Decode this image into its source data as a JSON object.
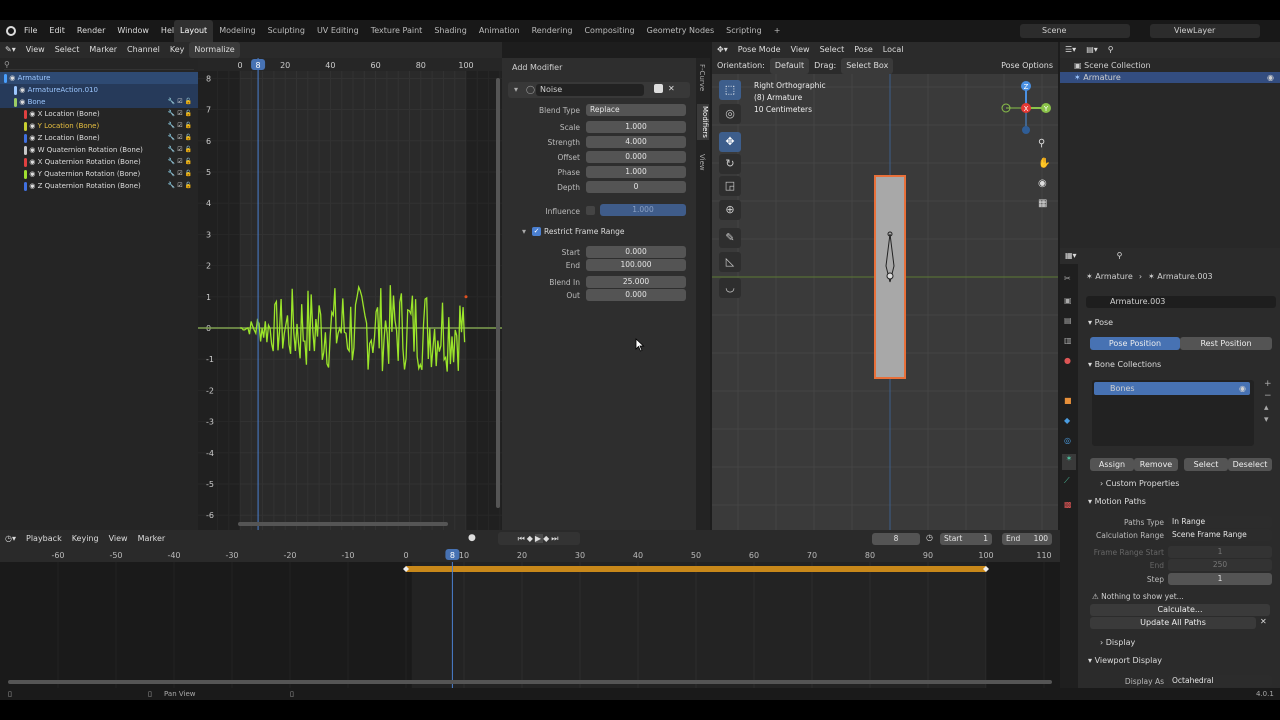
{
  "topbar": {
    "menus": [
      "File",
      "Edit",
      "Render",
      "Window",
      "Help"
    ],
    "workspaces": [
      "Layout",
      "Modeling",
      "Sculpting",
      "UV Editing",
      "Texture Paint",
      "Shading",
      "Animation",
      "Rendering",
      "Compositing",
      "Geometry Nodes",
      "Scripting"
    ],
    "active_workspace": "Layout",
    "add_tab": "+",
    "scene": "Scene",
    "viewlayer": "ViewLayer"
  },
  "graph": {
    "menus": [
      "View",
      "Select",
      "Marker",
      "Channel",
      "Key"
    ],
    "normalize": "Normalize",
    "ruler_x": [
      "0",
      "20",
      "40",
      "60",
      "80",
      "100"
    ],
    "current_frame": "8",
    "ruler_y": [
      "8",
      "7",
      "6",
      "5",
      "4",
      "3",
      "2",
      "1",
      "0",
      "-1",
      "-2",
      "-3",
      "-4",
      "-5",
      "-6"
    ],
    "channels": [
      {
        "name": "Armature",
        "color": "#4aa0ff",
        "level": 0
      },
      {
        "name": "ArmatureAction.010",
        "color": "#9cc7ff",
        "level": 1
      },
      {
        "name": "Bone",
        "color": "#9ccc65",
        "level": 1
      },
      {
        "name": "X Location (Bone)",
        "color": "#e04040",
        "level": 2
      },
      {
        "name": "Y Location (Bone)",
        "color": "#c8d030",
        "level": 2
      },
      {
        "name": "Z Location (Bone)",
        "color": "#4070e0",
        "level": 2
      },
      {
        "name": "W Quaternion Rotation (Bone)",
        "color": "#c8c8c8",
        "level": 2
      },
      {
        "name": "X Quaternion Rotation (Bone)",
        "color": "#e04040",
        "level": 2
      },
      {
        "name": "Y Quaternion Rotation (Bone)",
        "color": "#a0e030",
        "level": 2
      },
      {
        "name": "Z Quaternion Rotation (Bone)",
        "color": "#4070e0",
        "level": 2
      }
    ]
  },
  "modifier": {
    "add": "Add Modifier",
    "name": "Noise",
    "blend_type_label": "Blend Type",
    "blend_type": "Replace",
    "scale_label": "Scale",
    "scale": "1.000",
    "strength_label": "Strength",
    "strength": "4.000",
    "offset_label": "Offset",
    "offset": "0.000",
    "phase_label": "Phase",
    "phase": "1.000",
    "depth_label": "Depth",
    "depth": "0",
    "influence_label": "Influence",
    "influence": "1.000",
    "restrict_label": "Restrict Frame Range",
    "start_label": "Start",
    "start": "0.000",
    "end_label": "End",
    "end": "100.000",
    "blend_in_label": "Blend In",
    "blend_in": "25.000",
    "out_label": "Out",
    "out": "0.000",
    "tabs": [
      "F-Curve",
      "Modifiers",
      "View"
    ]
  },
  "viewport": {
    "mode": "Pose Mode",
    "menus": [
      "View",
      "Select",
      "Pose"
    ],
    "transform": "Local",
    "orientation_label": "Orientation:",
    "orientation": "Default",
    "drag_label": "Drag:",
    "drag": "Select Box",
    "pose_options": "Pose Options",
    "info": [
      "Right Orthographic",
      "(8) Armature",
      "10 Centimeters"
    ],
    "gizmo": {
      "z": "Z",
      "y": "Y",
      "x": "X"
    }
  },
  "outliner": {
    "scene_collection": "Scene Collection",
    "armature": "Armature"
  },
  "properties": {
    "breadcrumb": [
      "Armature",
      "Armature.003"
    ],
    "data_name": "Armature.003",
    "pose_header": "Pose",
    "pose_position": "Pose Position",
    "rest_position": "Rest Position",
    "bone_collections": "Bone Collections",
    "bones": "Bones",
    "assign": "Assign",
    "remove": "Remove",
    "select": "Select",
    "deselect": "Deselect",
    "custom_props": "Custom Properties",
    "motion_paths": "Motion Paths",
    "paths_type_label": "Paths Type",
    "paths_type": "In Range",
    "calc_range_label": "Calculation Range",
    "calc_range": "Scene Frame Range",
    "frame_start_label": "Frame Range Start",
    "frame_start": "1",
    "end_label": "End",
    "end": "250",
    "step_label": "Step",
    "step": "1",
    "nothing": "Nothing to show yet...",
    "calculate": "Calculate...",
    "update_all": "Update All Paths",
    "display": "Display",
    "viewport_display": "Viewport Display",
    "display_as_label": "Display As",
    "display_as": "Octahedral"
  },
  "timeline": {
    "menus": [
      "Playback",
      "Keying",
      "View",
      "Marker"
    ],
    "frame": "8",
    "start_label": "Start",
    "start": "1",
    "end_label": "End",
    "end": "100",
    "ruler": [
      "-60",
      "-50",
      "-40",
      "-30",
      "-20",
      "-10",
      "0",
      "10",
      "20",
      "30",
      "40",
      "50",
      "60",
      "70",
      "80",
      "90",
      "100",
      "110"
    ],
    "current": "8"
  },
  "status": {
    "pan": "Pan View",
    "version": "4.0.1"
  }
}
